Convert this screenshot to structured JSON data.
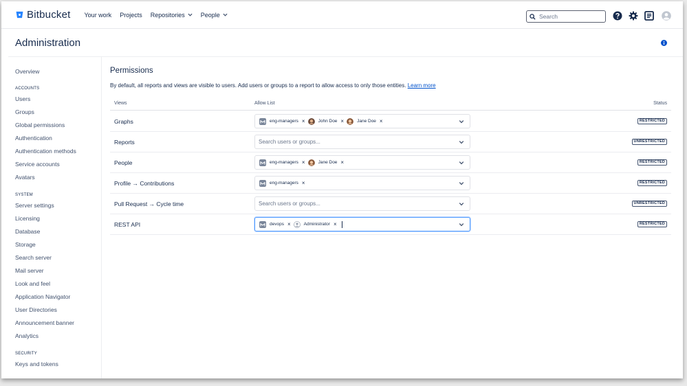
{
  "header": {
    "app_name": "Bitbucket",
    "nav": [
      {
        "label": "Your work",
        "dropdown": false
      },
      {
        "label": "Projects",
        "dropdown": false
      },
      {
        "label": "Repositories",
        "dropdown": true
      },
      {
        "label": "People",
        "dropdown": true
      }
    ],
    "search_placeholder": "Search",
    "icons": [
      "help-icon",
      "settings-icon",
      "notes-icon",
      "avatar"
    ],
    "brand_color": "#2684FF"
  },
  "page": {
    "title": "Administration",
    "info_icon": "info-icon"
  },
  "sidebar": {
    "overview": "Overview",
    "sections": [
      {
        "heading": "ACCOUNTS",
        "items": [
          "Users",
          "Groups",
          "Global permissions",
          "Authentication",
          "Authentication methods",
          "Service accounts",
          "Avatars"
        ]
      },
      {
        "heading": "SYSTEM",
        "items": [
          "Server settings",
          "Licensing",
          "Database",
          "Storage",
          "Search server",
          "Mail server",
          "Look and feel",
          "Application Navigator",
          "User Directories",
          "Announcement banner",
          "Analytics"
        ]
      },
      {
        "heading": "SECURITY",
        "items": [
          "Keys and tokens"
        ]
      }
    ]
  },
  "permissions": {
    "title": "Permissions",
    "description": "By default, all reports and views are visible to users. Add users or groups to a report to allow access to only those entities.",
    "learn_more": "Learn more",
    "columns": {
      "views": "Views",
      "allow_list": "Allow List",
      "status": "Status"
    },
    "select_placeholder": "Search users or groups...",
    "rows": [
      {
        "view": "Graphs",
        "tags": [
          {
            "label": "eng-managers",
            "type": "group"
          },
          {
            "label": "John Doe",
            "type": "user"
          },
          {
            "label": "Jane Doe",
            "type": "user"
          }
        ],
        "status": "RESTRICTED",
        "focused": false
      },
      {
        "view": "Reports",
        "tags": [],
        "status": "UNRESTRICTED",
        "focused": false
      },
      {
        "view": "People",
        "tags": [
          {
            "label": "eng-managers",
            "type": "group"
          },
          {
            "label": "Jane Doe",
            "type": "user"
          }
        ],
        "status": "RESTRICTED",
        "focused": false
      },
      {
        "view": "Profile → Contributions",
        "tags": [
          {
            "label": "eng-managers",
            "type": "group"
          }
        ],
        "status": "RESTRICTED",
        "focused": false
      },
      {
        "view": "Pull Request → Cycle time",
        "tags": [],
        "status": "UNRESTRICTED",
        "focused": false
      },
      {
        "view": "REST API",
        "tags": [
          {
            "label": "devops",
            "type": "group"
          },
          {
            "label": "Administrator",
            "type": "default-user"
          }
        ],
        "status": "RESTRICTED",
        "focused": true
      }
    ]
  }
}
